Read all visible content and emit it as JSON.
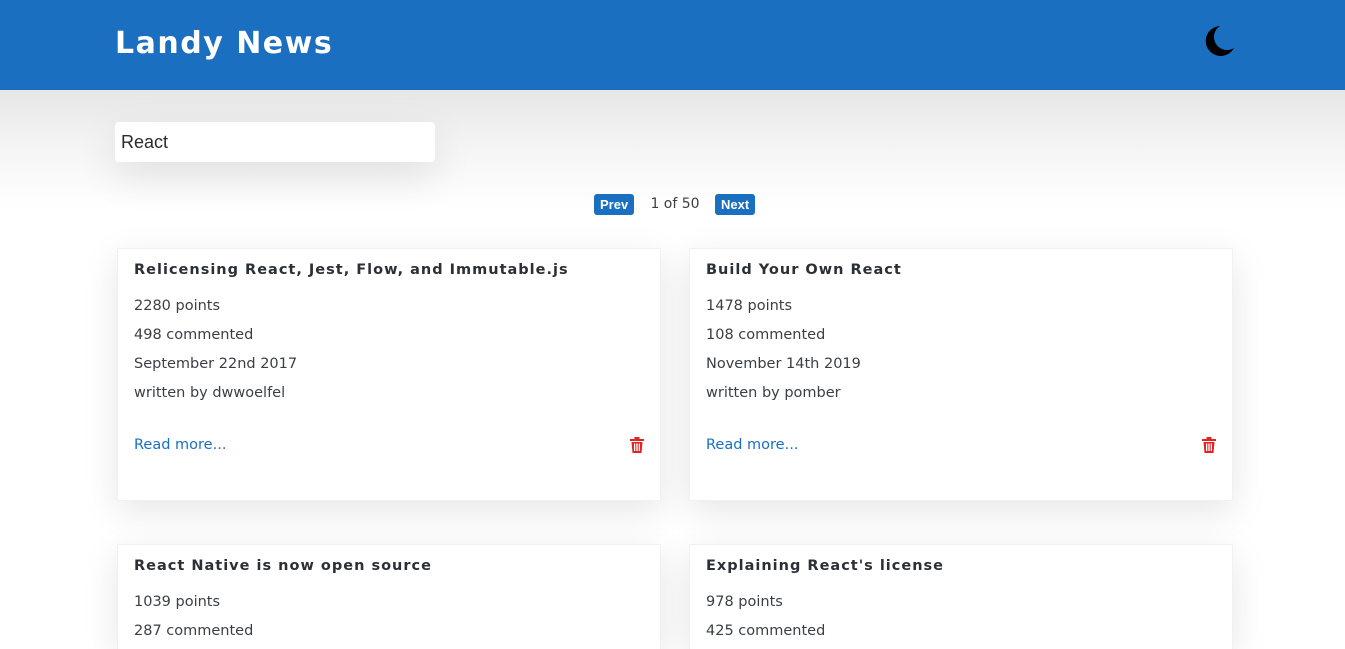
{
  "header": {
    "title": "Landy News",
    "theme_icon": "moon-icon"
  },
  "search": {
    "value": "React"
  },
  "pagination": {
    "prev_label": "Prev",
    "next_label": "Next",
    "page_text": "1 of 50"
  },
  "stories": [
    {
      "title": "Relicensing React, Jest, Flow, and Immutable.js",
      "points": "2280 points",
      "comments": "498 commented",
      "date": "September 22nd 2017",
      "author": "written by dwwoelfel",
      "read_more": "Read more..."
    },
    {
      "title": "Build Your Own React",
      "points": "1478 points",
      "comments": "108 commented",
      "date": "November 14th 2019",
      "author": "written by pomber",
      "read_more": "Read more..."
    },
    {
      "title": "React Native is now open source",
      "points": "1039 points",
      "comments": "287 commented",
      "date": "",
      "author": "",
      "read_more": ""
    },
    {
      "title": "Explaining React's license",
      "points": "978 points",
      "comments": "425 commented",
      "date": "",
      "author": "",
      "read_more": ""
    }
  ],
  "colors": {
    "brand_blue": "#1a6fc1",
    "delete_red": "#e02424"
  }
}
